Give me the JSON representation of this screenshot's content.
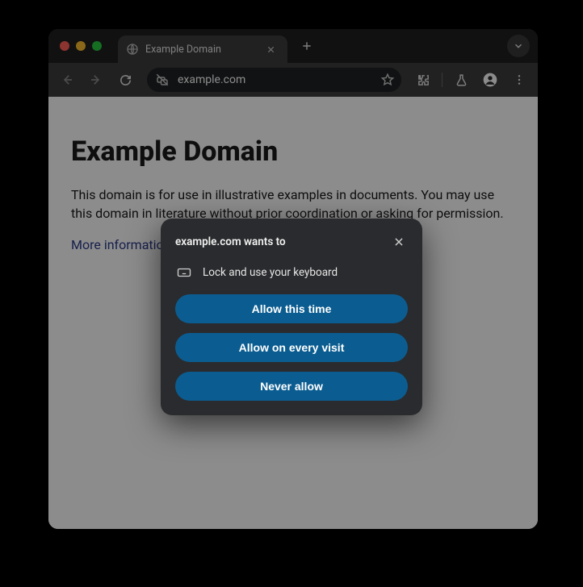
{
  "tab": {
    "title": "Example Domain"
  },
  "toolbar": {
    "url": "example.com"
  },
  "page": {
    "heading": "Example Domain",
    "paragraph": "This domain is for use in illustrative examples in documents. You may use this domain in literature without prior coordination or asking for permission.",
    "more_link": "More information..."
  },
  "permission": {
    "title": "example.com wants to",
    "request": "Lock and use your keyboard",
    "allow_once": "Allow this time",
    "allow_every": "Allow on every visit",
    "never": "Never allow"
  }
}
